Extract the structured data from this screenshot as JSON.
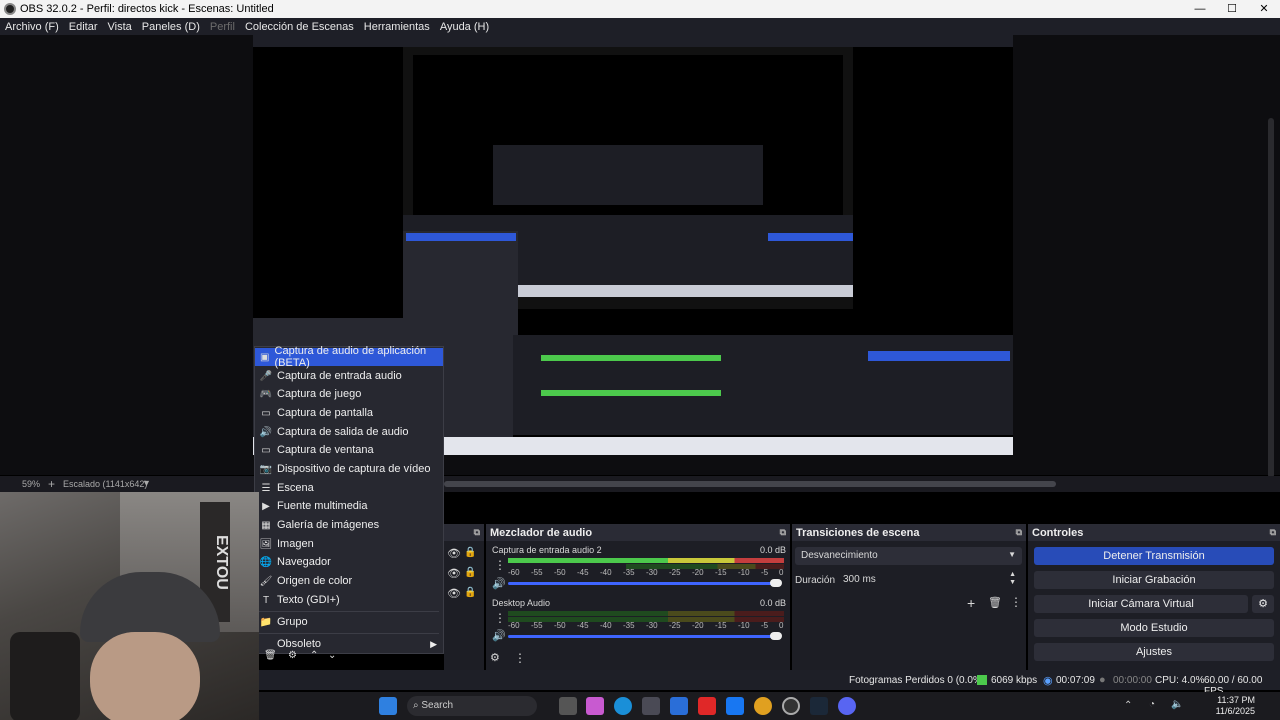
{
  "window": {
    "title": "OBS 32.0.2 - Perfil: directos kick - Escenas: Untitled",
    "min": "—",
    "max": "☐",
    "close": "✕"
  },
  "menu": [
    "Archivo (F)",
    "Editar",
    "Vista",
    "Paneles (D)",
    "Perfil",
    "Colección de Escenas",
    "Herramientas",
    "Ayuda (H)"
  ],
  "zoombar": {
    "zoom": "59%",
    "scale": "Escalado (1141x642)"
  },
  "context_menu": {
    "items": [
      {
        "label": "Captura de audio de aplicación (BETA)",
        "icon": "app-audio-icon"
      },
      {
        "label": "Captura de entrada audio",
        "icon": "microphone-icon"
      },
      {
        "label": "Captura de juego",
        "icon": "gamepad-icon"
      },
      {
        "label": "Captura de pantalla",
        "icon": "monitor-icon"
      },
      {
        "label": "Captura de salida de audio",
        "icon": "speaker-icon"
      },
      {
        "label": "Captura de ventana",
        "icon": "window-icon"
      },
      {
        "label": "Dispositivo de captura de vídeo",
        "icon": "camera-icon"
      },
      {
        "label": "Escena",
        "icon": "list-icon"
      },
      {
        "label": "Fuente multimedia",
        "icon": "play-icon"
      },
      {
        "label": "Galería de imágenes",
        "icon": "gallery-icon"
      },
      {
        "label": "Imagen",
        "icon": "image-icon"
      },
      {
        "label": "Navegador",
        "icon": "globe-icon"
      },
      {
        "label": "Origen de color",
        "icon": "brush-icon"
      },
      {
        "label": "Texto (GDI+)",
        "icon": "text-icon"
      },
      {
        "label": "Grupo",
        "icon": "folder-icon"
      },
      {
        "label": "Obsoleto",
        "icon": "chevron-right-icon"
      }
    ]
  },
  "mixer": {
    "title": "Mezclador de audio",
    "channels": [
      {
        "name": "Captura de entrada audio 2",
        "db": "0.0 dB"
      },
      {
        "name": "Desktop Audio",
        "db": "0.0 dB"
      }
    ],
    "ticks": [
      "-60",
      "-55",
      "-50",
      "-45",
      "-40",
      "-35",
      "-30",
      "-25",
      "-20",
      "-15",
      "-10",
      "-5",
      "0"
    ]
  },
  "transitions": {
    "title": "Transiciones de escena",
    "selected": "Desvanecimiento",
    "duration_label": "Duración",
    "duration_value": "300 ms"
  },
  "controls": {
    "title": "Controles",
    "stream": "Detener Transmisión",
    "record": "Iniciar Grabación",
    "virtualcam": "Iniciar Cámara Virtual",
    "studio": "Modo Estudio",
    "settings": "Ajustes"
  },
  "status": {
    "dropped": "Fotogramas Perdidos 0 (0.0%)",
    "bitrate": "6069 kbps",
    "stream_time": "00:07:09",
    "rec_time": "00:00:00",
    "cpu": "CPU: 4.0%",
    "fps": "60.00 / 60.00 FPS"
  },
  "taskbar": {
    "search": "Search",
    "time": "11:37 PM",
    "date": "11/6/2025"
  },
  "webcam_text": "EXTOU",
  "colors": {
    "accent": "#2e58d8",
    "stream_btn": "#284cb8",
    "dock_bg": "#1d1e25"
  }
}
